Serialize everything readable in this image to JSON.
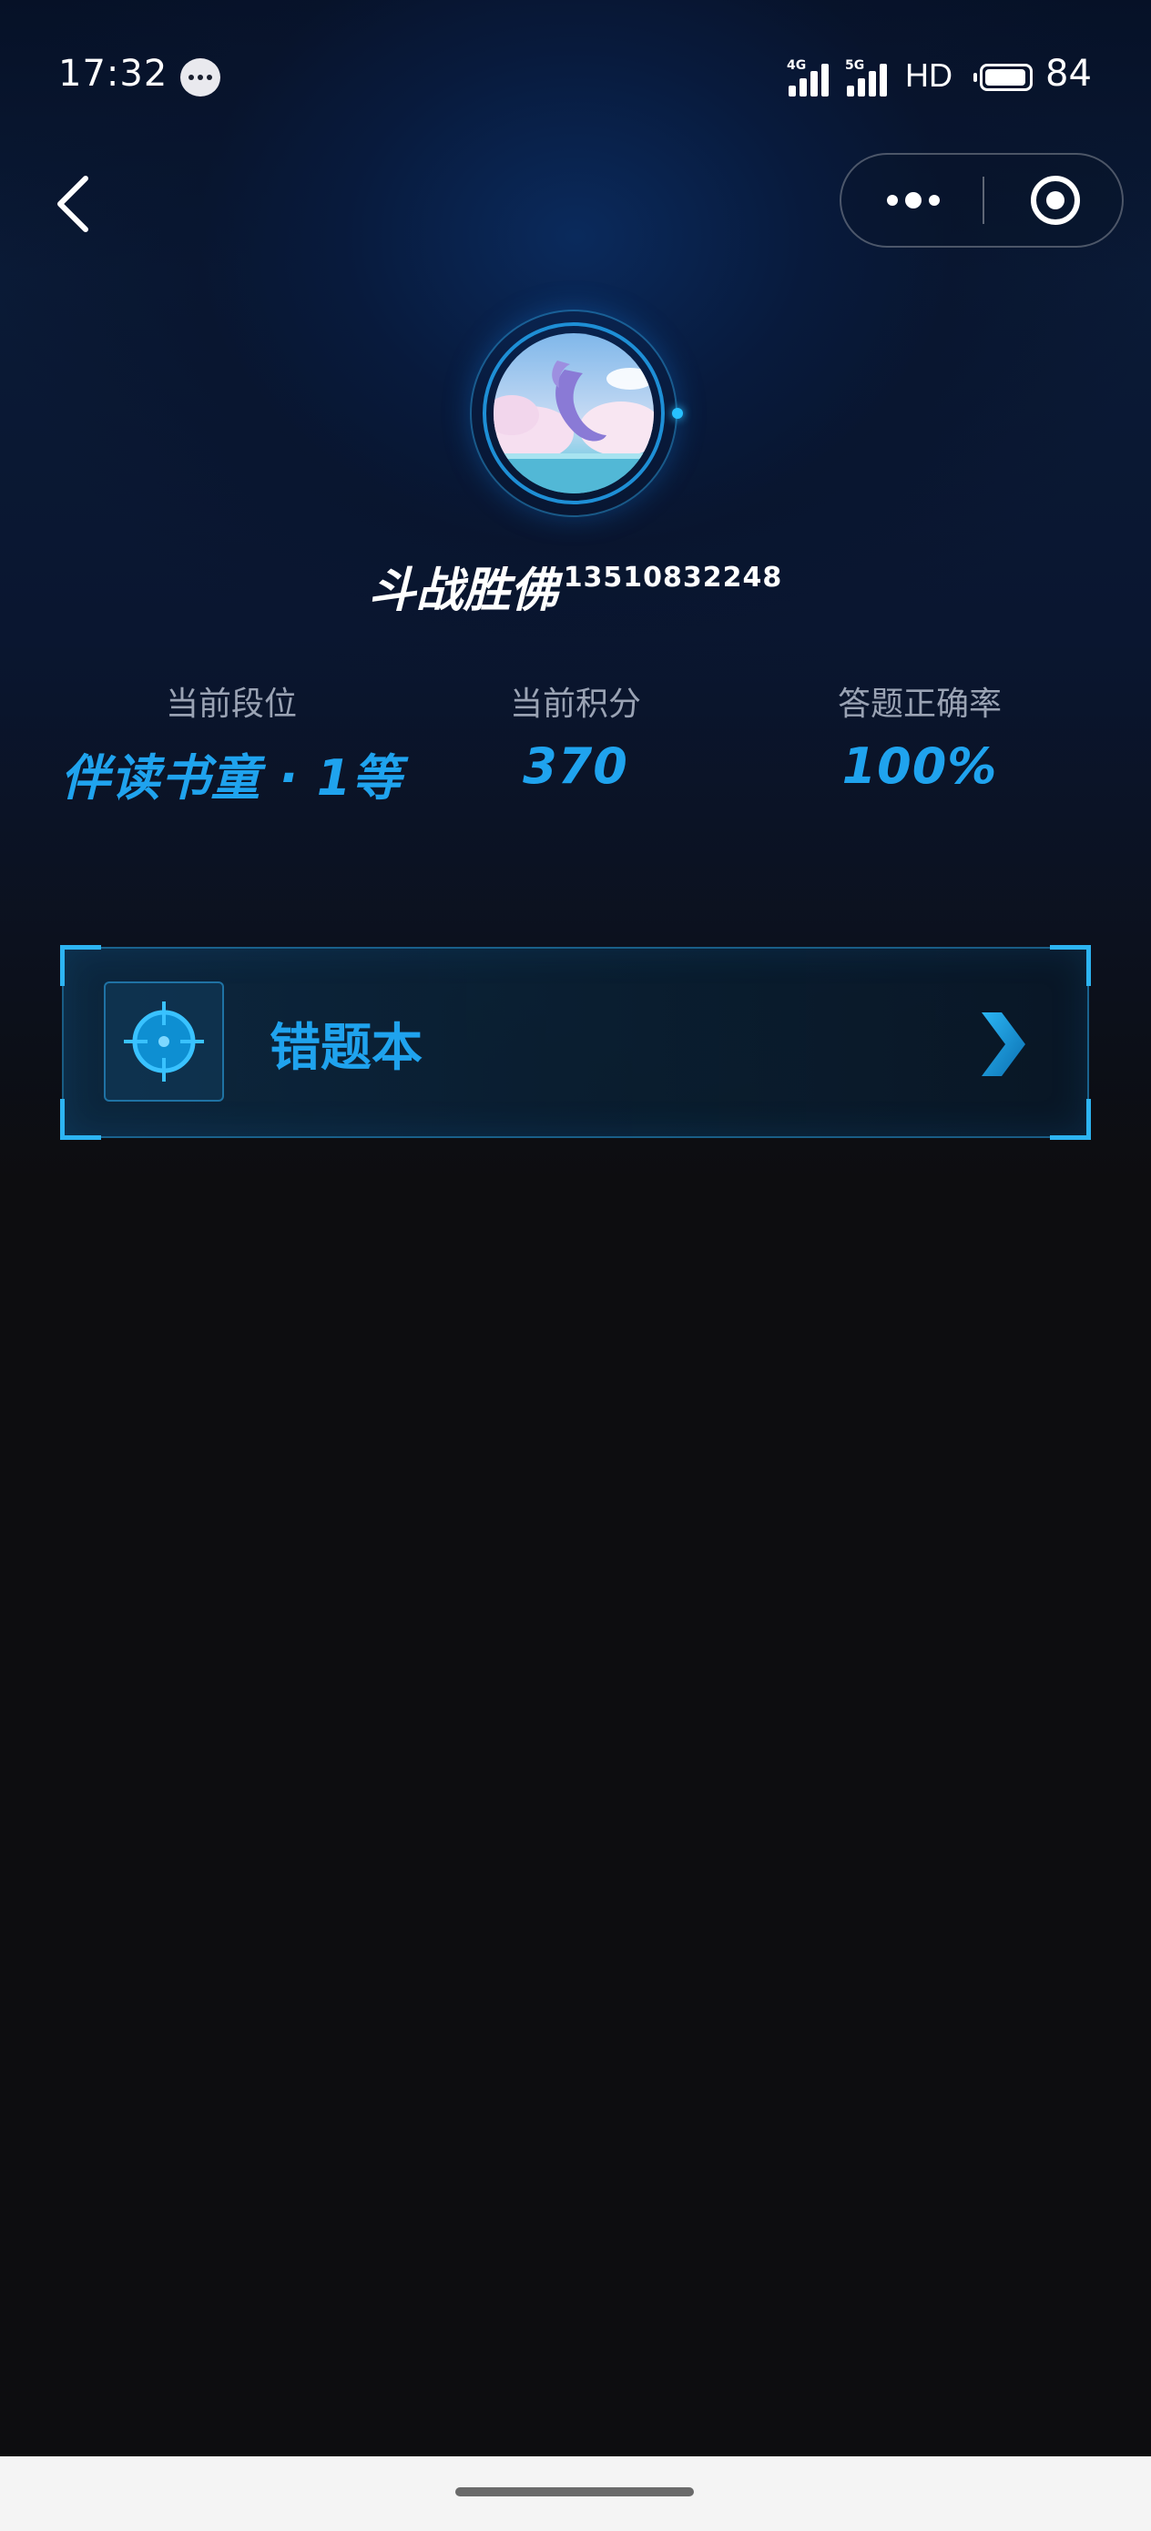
{
  "status_bar": {
    "time": "17:32",
    "network_1": "4G",
    "network_2": "5G",
    "hd_label": "HD",
    "battery_level": "84"
  },
  "profile": {
    "name": "斗战胜佛",
    "phone": "13510832248"
  },
  "stats": [
    {
      "label": "当前段位",
      "value": "伴读书童 · 1等"
    },
    {
      "label": "当前积分",
      "value": "370"
    },
    {
      "label": "答题正确率",
      "value": "100%"
    }
  ],
  "wrong_book": {
    "title": "错题本",
    "icon": "crosshair-icon"
  },
  "colors": {
    "accent": "#1fa3ee",
    "background": "#0d0d10",
    "label": "#9aa3b4"
  }
}
